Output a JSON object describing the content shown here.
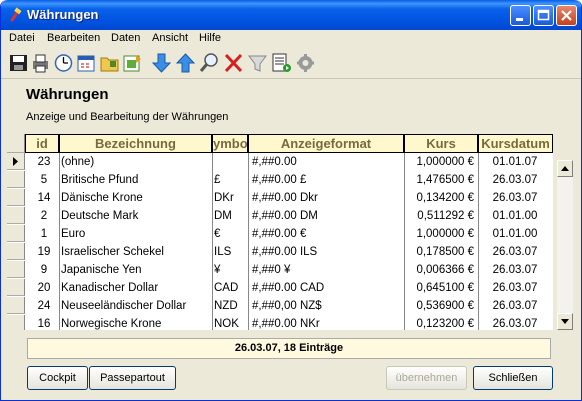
{
  "window": {
    "title": "Währungen"
  },
  "menu": [
    "Datei",
    "Bearbeiten",
    "Daten",
    "Ansicht",
    "Hilfe"
  ],
  "toolbar": {
    "icons": [
      "save-icon",
      "print-icon",
      "clock-icon",
      "calendar-icon",
      "folder-icon",
      "export-icon",
      "arrow-down-icon",
      "arrow-up-icon",
      "magnifier-icon",
      "delete-x-icon",
      "filter-funnel-icon",
      "report-icon",
      "settings-icon"
    ]
  },
  "page": {
    "heading": "Währungen",
    "subtitle": "Anzeige und Bearbeitung der Währungen"
  },
  "table": {
    "columns": [
      "id",
      "Bezeichnung",
      "ymbo",
      "Anzeigeformat",
      "Kurs",
      "Kursdatum"
    ],
    "rows": [
      [
        "23",
        "(ohne)",
        "",
        "#,##0.00",
        "1,000000 €",
        "01.01.07"
      ],
      [
        "5",
        "Britische Pfund",
        "£",
        "#,##0.00 £",
        "1,476500 €",
        "26.03.07"
      ],
      [
        "14",
        "Dänische Krone",
        "DKr",
        "#,##0.00 Dkr",
        "0,134200 €",
        "26.03.07"
      ],
      [
        "2",
        "Deutsche Mark",
        "DM",
        "#,##0.00 DM",
        "0,511292 €",
        "01.01.00"
      ],
      [
        "1",
        "Euro",
        "€",
        "#,##0.00 €",
        "1,000000 €",
        "01.01.00"
      ],
      [
        "19",
        "Israelischer Schekel",
        "ILS",
        "#,##0.00 ILS",
        "0,178500 €",
        "26.03.07"
      ],
      [
        "9",
        "Japanische Yen",
        "¥",
        "#,##0 ¥",
        "0,006366 €",
        "26.03.07"
      ],
      [
        "20",
        "Kanadischer Dollar",
        "CAD",
        "#,##0.00 CAD",
        "0,645100 €",
        "26.03.07"
      ],
      [
        "24",
        "Neuseeländischer Dollar",
        "NZD",
        "#,##0,00 NZ$",
        "0,536900 €",
        "26.03.07"
      ],
      [
        "16",
        "Norwegische Krone",
        "NOK",
        "#,##0.00 NKr",
        "0,123200 €",
        "26.03.07"
      ]
    ]
  },
  "status": "26.03.07, 18 Einträge",
  "buttons": {
    "cockpit": "Cockpit",
    "passepartout": "Passepartout",
    "apply": "übernehmen",
    "close": "Schließen"
  }
}
